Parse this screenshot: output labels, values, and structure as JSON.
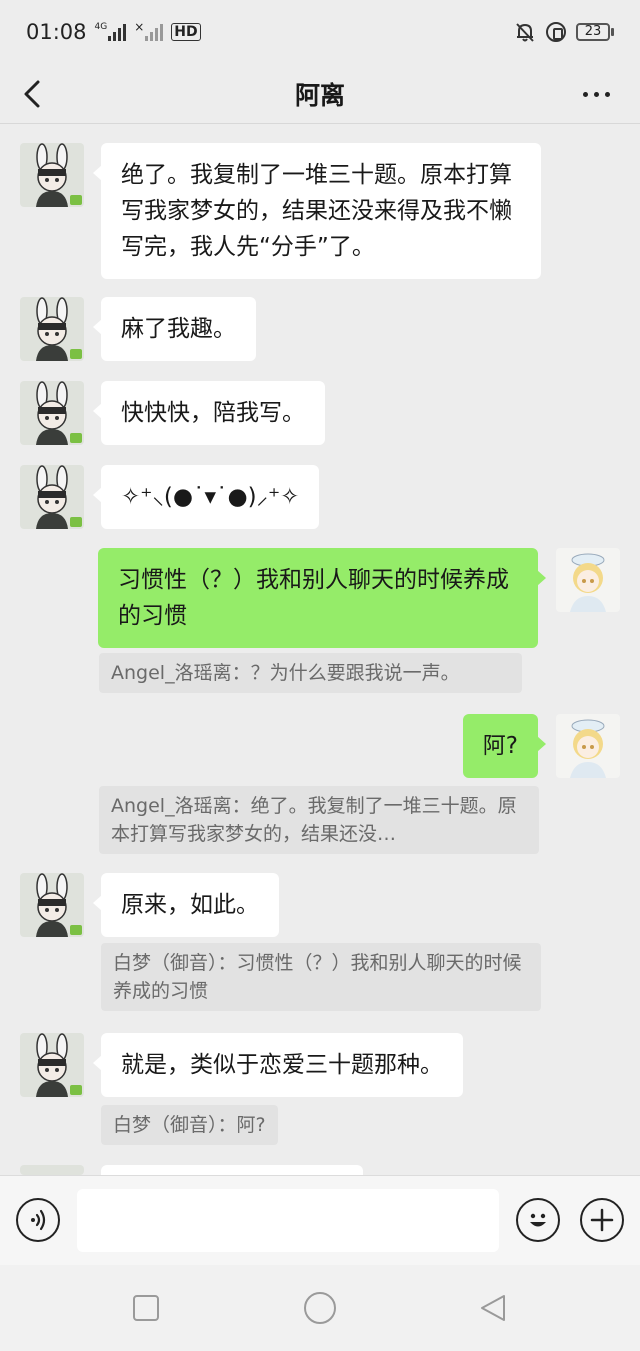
{
  "status": {
    "time": "01:08",
    "net1": "4G",
    "hd": "HD",
    "battery": "23"
  },
  "header": {
    "title": "阿离"
  },
  "messages": [
    {
      "side": "in",
      "text": "绝了。我复制了一堆三十题。原本打算写我家梦女的，结果还没来得及我不懒写完，我人先“分手”了。"
    },
    {
      "side": "in",
      "text": "麻了我趣。"
    },
    {
      "side": "in",
      "text": "快快快，陪我写。"
    },
    {
      "side": "in",
      "text": "✧⁺⸜(●˙▾˙●)⸝⁺✧"
    },
    {
      "side": "out",
      "text": "习惯性（？）我和别人聊天的时候养成的习惯",
      "quote": "Angel_洛瑶离：？为什么要跟我说一声。"
    },
    {
      "side": "out",
      "text": "阿?",
      "quote": "Angel_洛瑶离：绝了。我复制了一堆三十题。原本打算写我家梦女的，结果还没…"
    },
    {
      "side": "in",
      "text": "原来，如此。",
      "quote": "白梦（御音）：习惯性（？）我和别人聊天的时候养成的习惯"
    },
    {
      "side": "in",
      "text": "就是，类似于恋爱三十题那种。",
      "quote": "白梦（御音）：阿?"
    }
  ],
  "composer": {
    "placeholder": ""
  },
  "colors": {
    "background": "#ededed",
    "outgoing_bubble": "#95ec69",
    "incoming_bubble": "#ffffff",
    "quote_bg": "#e2e2e2"
  }
}
